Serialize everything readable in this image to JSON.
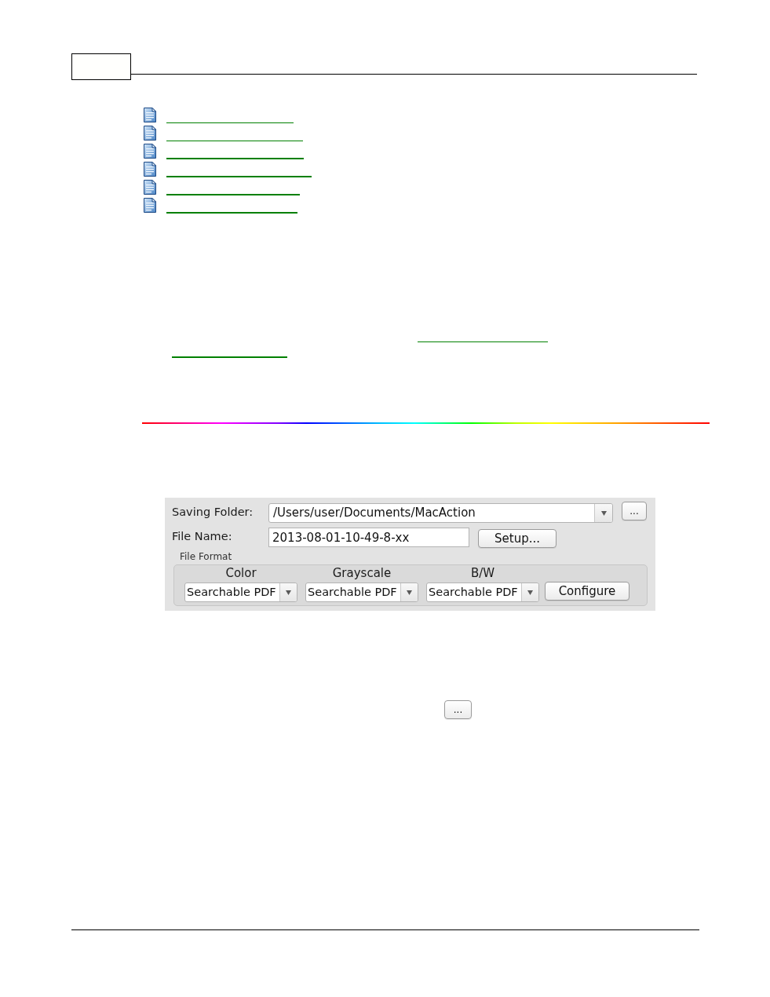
{
  "topic_links": [
    {
      "kind": "document"
    },
    {
      "kind": "document"
    },
    {
      "kind": "document"
    },
    {
      "kind": "document"
    },
    {
      "kind": "document"
    },
    {
      "kind": "document"
    }
  ],
  "settings_panel": {
    "saving_folder": {
      "label": "Saving Folder:",
      "value": "/Users/user/Documents/MacAction",
      "button": "..."
    },
    "file_name": {
      "label": "File Name:",
      "value": "2013-08-01-10-49-8-xx",
      "button": "Setup..."
    },
    "file_format": {
      "title": "File Format",
      "columns": [
        {
          "label": "Color",
          "value": "Searchable PDF"
        },
        {
          "label": "Grayscale",
          "value": "Searchable PDF"
        },
        {
          "label": "B/W",
          "value": "Searchable PDF"
        }
      ],
      "button": "Configure"
    }
  },
  "browse_button": {
    "label": "..."
  }
}
